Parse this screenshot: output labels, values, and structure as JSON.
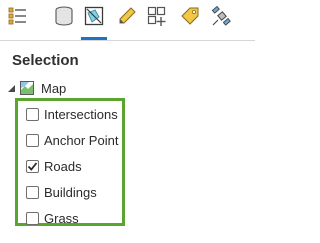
{
  "toolbar": {
    "buttons": [
      {
        "icon": "list-by-drawing-order-icon"
      },
      {
        "icon": "list-by-data-source-icon"
      },
      {
        "icon": "list-by-selection-icon",
        "active": true
      },
      {
        "icon": "list-by-editing-icon"
      },
      {
        "icon": "list-by-snapping-icon"
      },
      {
        "icon": "list-by-labeling-icon"
      },
      {
        "icon": "list-by-perspective-imagery-icon"
      }
    ],
    "active_accent": "#1a73c6"
  },
  "panel": {
    "heading": "Selection",
    "root": {
      "label": "Map",
      "expanded": true
    },
    "layers": [
      {
        "label": "Intersections",
        "checked": false
      },
      {
        "label": "Anchor Point",
        "checked": false
      },
      {
        "label": "Roads",
        "checked": true
      },
      {
        "label": "Buildings",
        "checked": false
      },
      {
        "label": "Grass",
        "checked": false
      }
    ],
    "highlight_color": "#5aa52e"
  }
}
